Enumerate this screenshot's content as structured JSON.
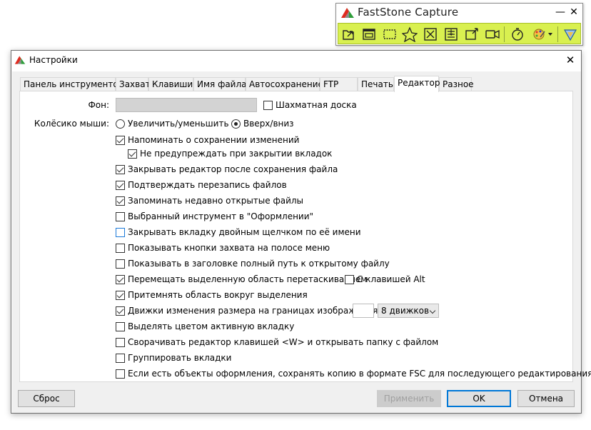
{
  "capture_toolbar": {
    "title": "FastStone Capture",
    "minimize_glyph": "—",
    "close_glyph": "✕",
    "tools": [
      {
        "icon": "open-file-icon"
      },
      {
        "icon": "capture-window-icon"
      },
      {
        "icon": "capture-rectangle-icon"
      },
      {
        "icon": "capture-freehand-icon"
      },
      {
        "icon": "capture-fullscreen-icon"
      },
      {
        "icon": "capture-scrolling-icon"
      },
      {
        "icon": "capture-fixed-region-icon"
      },
      {
        "icon": "screen-recorder-icon"
      },
      {
        "icon": "delay-timer-icon"
      },
      {
        "icon": "output-settings-icon"
      },
      {
        "icon": "settings-icon"
      }
    ],
    "colors": {
      "bar": "#d9f050"
    }
  },
  "dialog": {
    "title": "Настройки",
    "close_glyph": "✕",
    "tabs": [
      {
        "label": "Панель инструментов"
      },
      {
        "label": "Захват"
      },
      {
        "label": "Клавиши"
      },
      {
        "label": "Имя файла"
      },
      {
        "label": "Автосохранение"
      },
      {
        "label": "FTP"
      },
      {
        "label": "Печать"
      },
      {
        "label": "Редактор",
        "active": true
      },
      {
        "label": "Разное"
      }
    ],
    "editor": {
      "background_label": "Фон:",
      "background_color": "#d3d3d3",
      "chessboard_label": "Шахматная доска",
      "chessboard_checked": false,
      "mouse_wheel_label": "Колёсико мыши:",
      "wheel_options": [
        {
          "label": "Увеличить/уменьшить",
          "selected": false
        },
        {
          "label": "Вверх/вниз",
          "selected": true
        }
      ],
      "options": [
        {
          "label": "Напоминать о сохранении изменений",
          "checked": true
        },
        {
          "label": "Не предупреждать при закрытии вкладок",
          "checked": true
        },
        {
          "label": "Закрывать редактор после сохранения файла",
          "checked": true
        },
        {
          "label": "Подтверждать перезапись файлов",
          "checked": true
        },
        {
          "label": "Запоминать недавно открытые файлы",
          "checked": true
        },
        {
          "label": "Выбранный инструмент в \"Оформлении\"",
          "checked": false
        },
        {
          "label": "Закрывать вкладку двойным щелчком по её имени",
          "checked": false
        },
        {
          "label": "Показывать кнопки захвата на полосе меню",
          "checked": false
        },
        {
          "label": "Показывать в заголовке полный путь к открытому файлу",
          "checked": false
        },
        {
          "label": "Перемещать выделенную область перетаскиванием",
          "checked": true
        },
        {
          "label": "Притемнять область вокруг выделения",
          "checked": true
        },
        {
          "label": "Движки изменения размера на границах изображения",
          "checked": true
        },
        {
          "label": "Выделять цветом активную вкладку",
          "checked": false
        },
        {
          "label": "Сворачивать редактор клавишей <W> и открывать папку с файлом",
          "checked": false
        },
        {
          "label": "Группировать вкладки",
          "checked": false
        },
        {
          "label": "Если есть объекты оформления, сохранять копию в формате FSC для последующего редактирования",
          "checked": false
        }
      ],
      "alt_key_label": "С клавишей Alt",
      "alt_key_checked": false,
      "handles_select_value": "8 движков"
    },
    "buttons": {
      "reset": "Сброс",
      "apply": "Применить",
      "ok": "OK",
      "cancel": "Отмена"
    }
  }
}
